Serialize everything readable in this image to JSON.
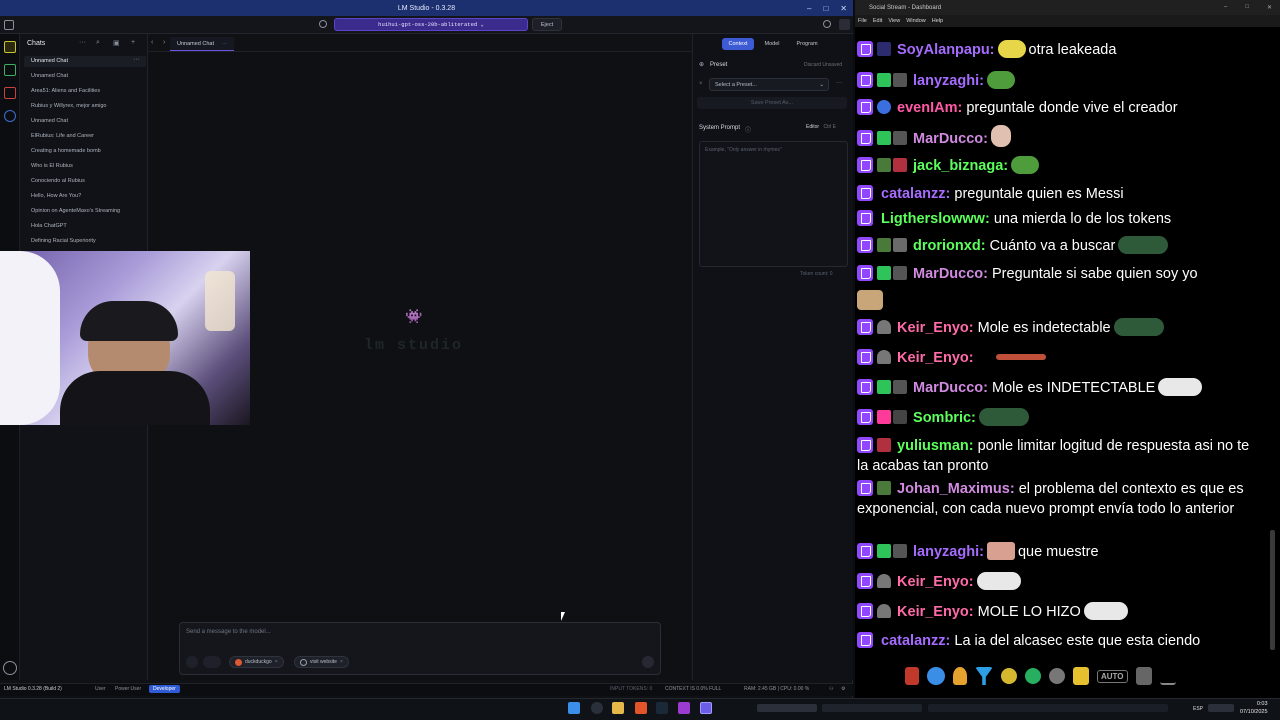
{
  "lmstudio": {
    "title": "LM Studio - 0.3.28",
    "model_selector": "huihui-gpt-oss-20b-abliterated",
    "eject_label": "Eject",
    "sidebar": {
      "heading": "Chats",
      "items": [
        "Unnamed Chat",
        "Unnamed Chat",
        "Area51: Aliens and Facilities",
        "Rubius y Willyrex, mejor amigo",
        "Unnamed Chat",
        "ElRubius: Life and Career",
        "Creating a homemade bomb",
        "Who is El Rubius",
        "Conociendo al Rubius",
        "Hello, How Are You?",
        "Opinion on AgenteMaxo's Streaming",
        "Hola ChatGPT",
        "Defining Racial Superiority"
      ]
    },
    "tab": "Unnamed Chat",
    "logo_text": "lm studio",
    "composer": {
      "placeholder": "Send a message to the model...",
      "chips": [
        "duckduckgo",
        "visit website"
      ]
    },
    "right_panel": {
      "tabs": [
        "Context",
        "Model",
        "Program"
      ],
      "preset_label": "Preset",
      "discard_label": "Discard Unsaved",
      "preset_select": "Select a Preset...",
      "save_preset": "Save Preset As...",
      "system_prompt_label": "System Prompt",
      "editor_label": "Editor",
      "editor_shortcut": "Ctrl E",
      "system_prompt_placeholder": "Example, \"Only answer in rhymes\"",
      "token_count": "Token count: 0"
    },
    "status_bar": {
      "app": "LM Studio 0.3.28 (Build 2)",
      "modes": [
        "User",
        "Power User",
        "Developer"
      ],
      "input_tokens": "INPUT TOKENS: 0",
      "context": "CONTEXT IS 0.0% FULL",
      "ram": "RAM: 2.45 GB | CPU: 0.00 %"
    }
  },
  "chat_window": {
    "title": "Social Stream - Dashboard",
    "menu": [
      "File",
      "Edit",
      "View",
      "Window",
      "Help"
    ],
    "messages": [
      {
        "user": "SoyAlanpapu:",
        "text": "otra leakeada",
        "color": "#a66cff"
      },
      {
        "user": "lanyzaghi:",
        "text": "",
        "color": "#a66cff"
      },
      {
        "user": "evenIAm:",
        "text": "preguntale donde vive el creador",
        "color": "#ff5aa6"
      },
      {
        "user": "MarDucco:",
        "text": "",
        "color": "#d08ae0"
      },
      {
        "user": "jack_biznaga:",
        "text": "",
        "color": "#5cff5c"
      },
      {
        "user": "catalanzz:",
        "text": "preguntale quien es Messi",
        "color": "#a66cff"
      },
      {
        "user": "Ligtherslowww:",
        "text": "una mierda lo de los tokens",
        "color": "#5cff5c"
      },
      {
        "user": "drorionxd:",
        "text": "Cuánto va a buscar",
        "color": "#5cff5c"
      },
      {
        "user": "MarDucco:",
        "text": "Preguntale si sabe quien soy yo",
        "color": "#d08ae0"
      },
      {
        "user": "Keir_Enyo:",
        "text": "Mole es indetectable",
        "color": "#ff6aa8"
      },
      {
        "user": "Keir_Enyo:",
        "text": "",
        "color": "#ff6aa8"
      },
      {
        "user": "MarDucco:",
        "text": "Mole es INDETECTABLE",
        "color": "#d08ae0"
      },
      {
        "user": "Sombric:",
        "text": "",
        "color": "#5cff5c"
      },
      {
        "user": "yuliusman:",
        "text": "ponle limitar logitud de respuesta asi no te la acabas tan pronto",
        "color": "#5cff5c"
      },
      {
        "user": "Johan_Maximus:",
        "text": "el problema del contexto es que es exponencial, con cada nuevo prompt envía todo lo anterior",
        "color": "#d08ae0"
      },
      {
        "user": "lanyzaghi:",
        "text": "que muestre",
        "color": "#a66cff"
      },
      {
        "user": "Keir_Enyo:",
        "text": "",
        "color": "#ff6aa8"
      },
      {
        "user": "Keir_Enyo:",
        "text": "MOLE LO HIZO",
        "color": "#ff6aa8"
      },
      {
        "user": "catalanzz:",
        "text": "La ia del alcasec este que esta ciendo",
        "color": "#a66cff"
      }
    ],
    "toolbar_auto": "AUTO"
  },
  "taskbar": {
    "lang": "ESP",
    "time": "0:03",
    "date": "07/10/2025"
  }
}
